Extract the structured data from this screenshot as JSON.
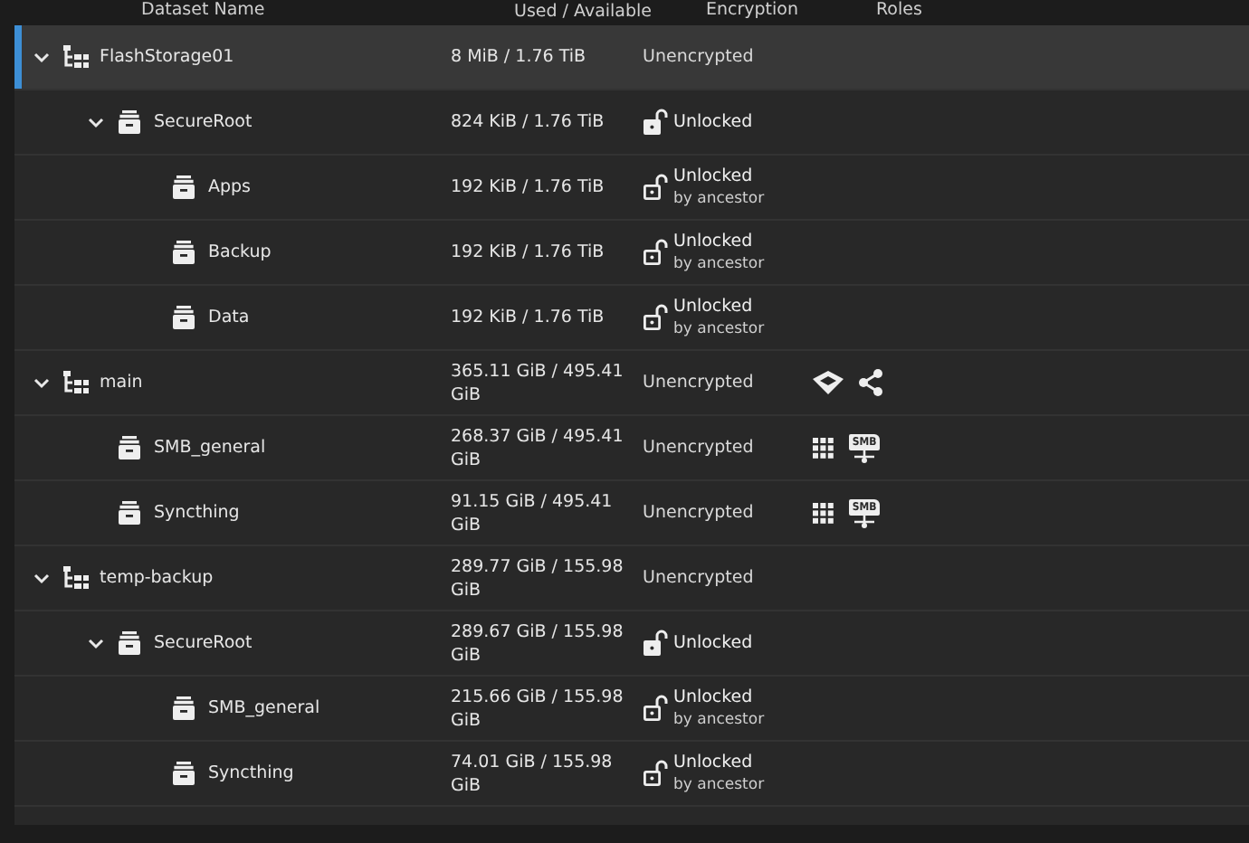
{
  "table": {
    "columns": [
      "Dataset Name",
      "Used / Available",
      "Encryption",
      "Roles"
    ],
    "rows": [
      {
        "name": "FlashStorage01",
        "kind": "pool",
        "expanded": true,
        "selected": true,
        "used": "8 MiB / 1.76 TiB",
        "encryption": {
          "kind": "none",
          "status": "Unencrypted"
        },
        "children": [
          {
            "name": "SecureRoot",
            "kind": "dataset",
            "expanded": true,
            "selected": false,
            "used": "824 KiB / 1.76 TiB",
            "encryption": {
              "kind": "root",
              "status": "Unlocked"
            },
            "children": [
              {
                "name": "Apps",
                "kind": "dataset",
                "selected": false,
                "used": "192 KiB / 1.76 TiB",
                "encryption": {
                  "kind": "inherited",
                  "status": "Unlocked",
                  "note": "by ancestor"
                }
              },
              {
                "name": "Backup",
                "kind": "dataset",
                "selected": false,
                "used": "192 KiB / 1.76 TiB",
                "encryption": {
                  "kind": "inherited",
                  "status": "Unlocked",
                  "note": "by ancestor"
                }
              },
              {
                "name": "Data",
                "kind": "dataset",
                "selected": false,
                "used": "192 KiB / 1.76 TiB",
                "encryption": {
                  "kind": "inherited",
                  "status": "Unlocked",
                  "note": "by ancestor"
                }
              }
            ]
          }
        ]
      },
      {
        "name": "main",
        "kind": "pool",
        "expanded": true,
        "selected": false,
        "used": "365.11 GiB / 495.41 GiB",
        "encryption": {
          "kind": "none",
          "status": "Unencrypted"
        },
        "roles": [
          {
            "kind": "apps"
          },
          {
            "kind": "share"
          }
        ],
        "children": [
          {
            "name": "SMB_general",
            "kind": "dataset",
            "selected": false,
            "used": "268.37 GiB / 495.41 GiB",
            "encryption": {
              "kind": "none",
              "status": "Unencrypted"
            },
            "roles": [
              {
                "kind": "grid"
              },
              {
                "kind": "smb",
                "label": "SMB"
              }
            ]
          },
          {
            "name": "Syncthing",
            "kind": "dataset",
            "selected": false,
            "used": "91.15 GiB / 495.41 GiB",
            "encryption": {
              "kind": "none",
              "status": "Unencrypted"
            },
            "roles": [
              {
                "kind": "grid"
              },
              {
                "kind": "smb",
                "label": "SMB"
              }
            ]
          }
        ]
      },
      {
        "name": "temp-backup",
        "kind": "pool",
        "expanded": true,
        "selected": false,
        "used": "289.77 GiB / 155.98 GiB",
        "encryption": {
          "kind": "none",
          "status": "Unencrypted"
        },
        "children": [
          {
            "name": "SecureRoot",
            "kind": "dataset",
            "expanded": true,
            "selected": false,
            "used": "289.67 GiB / 155.98 GiB",
            "encryption": {
              "kind": "root",
              "status": "Unlocked"
            },
            "children": [
              {
                "name": "SMB_general",
                "kind": "dataset",
                "selected": false,
                "used": "215.66 GiB / 155.98 GiB",
                "encryption": {
                  "kind": "inherited",
                  "status": "Unlocked",
                  "note": "by ancestor"
                }
              },
              {
                "name": "Syncthing",
                "kind": "dataset",
                "selected": false,
                "used": "74.01 GiB / 155.98 GiB",
                "encryption": {
                  "kind": "inherited",
                  "status": "Unlocked",
                  "note": "by ancestor"
                }
              }
            ]
          }
        ]
      }
    ]
  }
}
